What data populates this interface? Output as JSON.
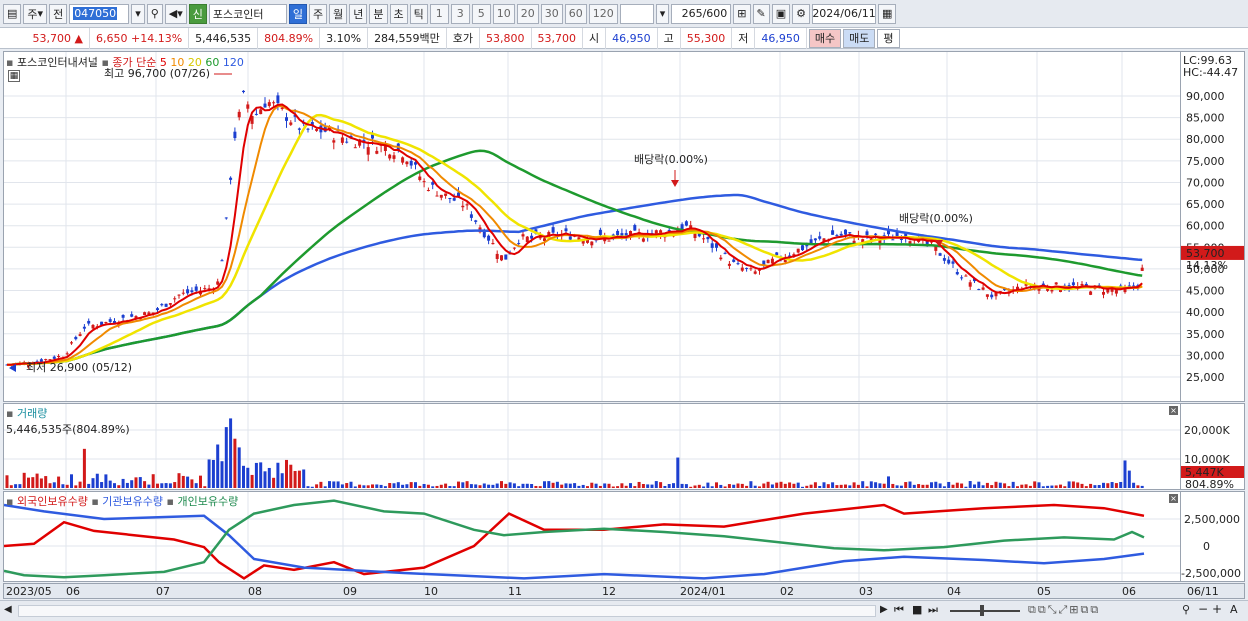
{
  "toolbar": {
    "type": "주",
    "prefix": "전",
    "code": "047050",
    "stock_name": "포스코인터",
    "new_badge": "신",
    "periods": [
      "일",
      "주",
      "월",
      "년",
      "분",
      "초",
      "틱"
    ],
    "numbers": [
      "1",
      "3",
      "5",
      "10",
      "20",
      "30",
      "60",
      "120"
    ],
    "count": "265",
    "total": "/600",
    "date": "2024/06/11"
  },
  "quote": {
    "price": "53,700",
    "price_arrow": "▲",
    "change": "6,650",
    "change_pct": "+14.13%",
    "volume": "5,446,535",
    "vol_pct": "804.89%",
    "turnover": "3.10%",
    "amount": "284,559백만",
    "ask_label": "호가",
    "ask1": "53,800",
    "ask2": "53,700",
    "open_label": "시",
    "open": "46,950",
    "high_label": "고",
    "high": "55,300",
    "low_label": "저",
    "low": "46,950",
    "buy": "매수",
    "sell": "매도",
    "eval": "평"
  },
  "price_panel": {
    "title": "포스코인터내셔널",
    "ma_label": "종가 단순",
    "ma_periods": [
      "5",
      "10",
      "20",
      "60",
      "120"
    ],
    "max_label": "최고 96,700 (07/26)",
    "min_label": "최저 26,900 (05/12)",
    "dividend1": "배당락(0.00%)",
    "dividend2": "배당락(0.00%)",
    "lc": "LC:99.63",
    "hc": "HC:-44.47",
    "current": "53,700",
    "current_pct": "14.13%",
    "yticks": [
      "90,000",
      "85,000",
      "80,000",
      "75,000",
      "70,000",
      "65,000",
      "60,000",
      "55,000",
      "50,000",
      "45,000",
      "40,000",
      "35,000",
      "30,000",
      "25,000"
    ]
  },
  "volume_panel": {
    "title": "거래량",
    "value": "5,446,535주(804.89%)",
    "yticks": [
      "20,000K",
      "10,000K"
    ],
    "current": "5,447K",
    "current_pct": "804.89%"
  },
  "holding_panel": {
    "foreign": "외국인보유수량",
    "institution": "기관보유수량",
    "individual": "개인보유수량",
    "yticks": [
      "2,500,000",
      "0",
      "-2,500,000"
    ]
  },
  "xaxis": [
    "2023/05",
    "06",
    "07",
    "08",
    "09",
    "10",
    "11",
    "12",
    "2024/01",
    "02",
    "03",
    "04",
    "05",
    "06",
    "06/11"
  ],
  "colors": {
    "up": "#d21a1a",
    "down": "#1c3fd0",
    "ma5": "#e00000",
    "ma10": "#f08a00",
    "ma20": "#f0e400",
    "ma60": "#1e9a2e",
    "ma120": "#2f5be0"
  }
}
